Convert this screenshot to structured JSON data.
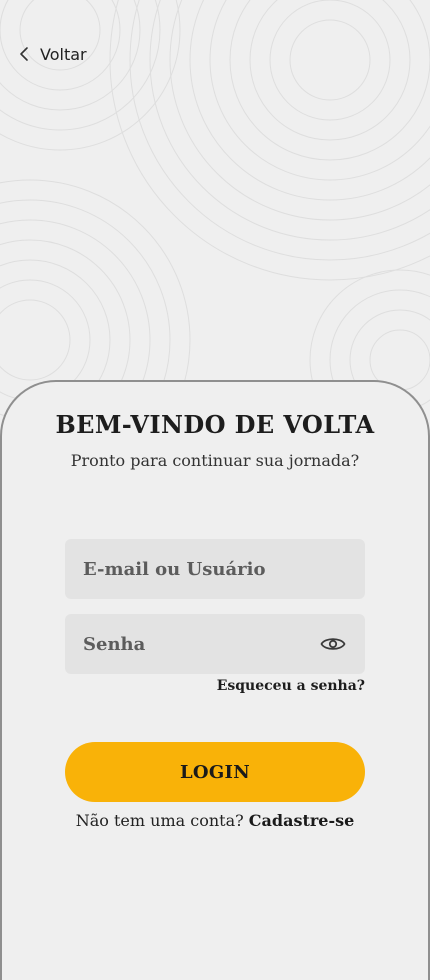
{
  "header": {
    "back_label": "Voltar"
  },
  "login": {
    "title": "BEM-VINDO DE VOLTA",
    "subtitle": "Pronto para continuar sua jornada?",
    "email_placeholder": "E-mail ou Usuário",
    "email_value": "",
    "password_placeholder": "Senha",
    "password_value": "",
    "forgot_label": "Esqueceu a senha?",
    "login_label": "LOGIN",
    "signup_prompt": "Não tem uma conta?",
    "signup_label": "Cadastre-se"
  },
  "icons": {
    "back": "chevron-left-icon",
    "password_toggle": "eye-icon"
  },
  "colors": {
    "background": "#efefef",
    "field": "#e3e3e3",
    "accent": "#f9b208",
    "card_border": "#8f8f8f",
    "text": "#1d1d1d"
  }
}
